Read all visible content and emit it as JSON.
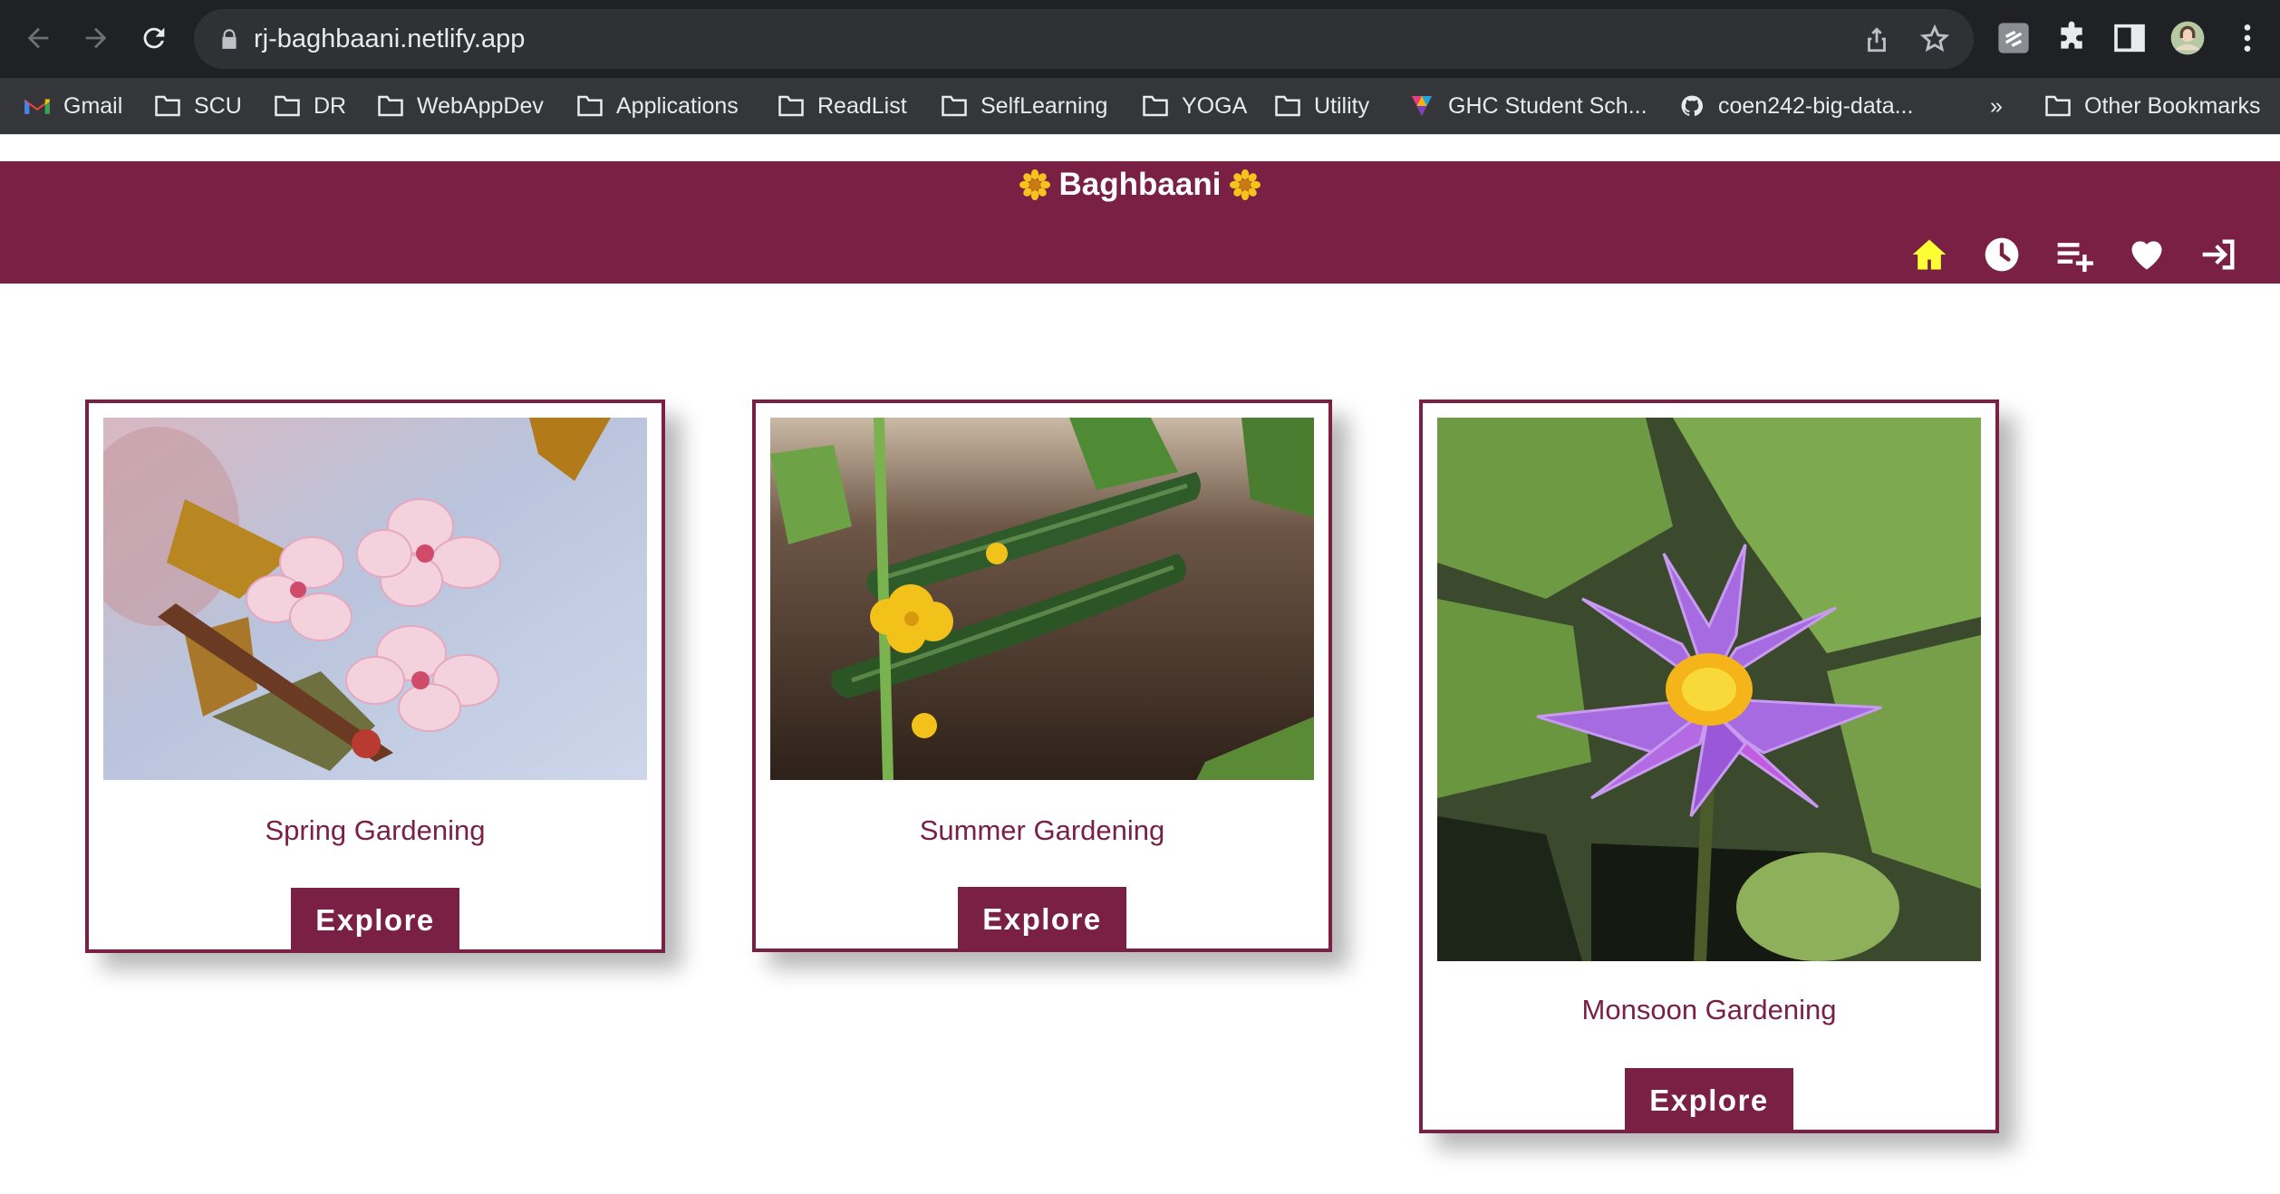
{
  "browser": {
    "url": "rj-baghbaani.netlify.app",
    "bookmarks": [
      {
        "label": "Gmail",
        "icon": "gmail-icon"
      },
      {
        "label": "SCU",
        "icon": "folder-icon"
      },
      {
        "label": "DR",
        "icon": "folder-icon"
      },
      {
        "label": "WebAppDev",
        "icon": "folder-icon"
      },
      {
        "label": "Applications",
        "icon": "folder-icon"
      },
      {
        "label": "ReadList",
        "icon": "folder-icon"
      },
      {
        "label": "SelfLearning",
        "icon": "folder-icon"
      },
      {
        "label": "YOGA",
        "icon": "folder-icon"
      },
      {
        "label": "Utility",
        "icon": "folder-icon"
      },
      {
        "label": "GHC Student Sch...",
        "icon": "ghc-icon"
      },
      {
        "label": "coen242-big-data...",
        "icon": "github-icon"
      }
    ],
    "overflow_label": "»",
    "other_bookmarks": "Other Bookmarks"
  },
  "header": {
    "brand": "Baghbaani",
    "brand_icon": "sunflower-icon",
    "nav_icons": [
      "home-icon",
      "clock-icon",
      "playlist-add-icon",
      "heart-icon",
      "login-icon"
    ],
    "active_color": "#ffff33",
    "background": "#7a2045"
  },
  "cards": [
    {
      "title": "Spring Gardening",
      "button": "Explore",
      "image": "cherry-blossom-photo"
    },
    {
      "title": "Summer Gardening",
      "button": "Explore",
      "image": "cucumber-photo"
    },
    {
      "title": "Monsoon Gardening",
      "button": "Explore",
      "image": "water-lily-photo"
    }
  ]
}
